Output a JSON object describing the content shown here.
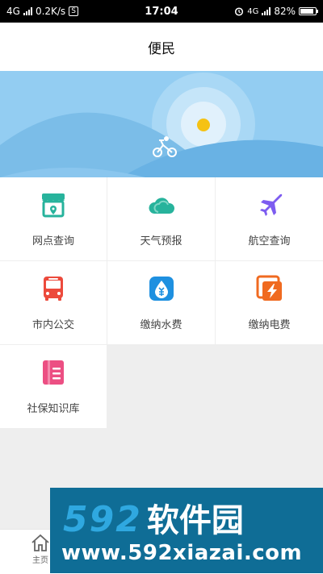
{
  "status_bar": {
    "network_left": "4G",
    "speed": "0.2K/s",
    "speed_badge": "S",
    "time": "17:04",
    "network_right": "4G",
    "battery": "82%"
  },
  "header": {
    "title": "便民"
  },
  "grid": {
    "items": [
      {
        "label": "网点查询",
        "icon": "store-location-icon"
      },
      {
        "label": "天气预报",
        "icon": "cloud-icon"
      },
      {
        "label": "航空查询",
        "icon": "airplane-icon"
      },
      {
        "label": "市内公交",
        "icon": "bus-icon"
      },
      {
        "label": "缴纳水费",
        "icon": "water-drop-icon"
      },
      {
        "label": "缴纳电费",
        "icon": "lightning-icon"
      },
      {
        "label": "社保知识库",
        "icon": "document-icon"
      }
    ]
  },
  "bottom_nav": {
    "home_label": "主页"
  },
  "watermark": {
    "number": "592",
    "name": "软件园",
    "url": "www.592xiazai.com"
  },
  "colors": {
    "teal": "#27b39c",
    "purple": "#7d5cf0",
    "red": "#ec4a3c",
    "blue": "#1e90e0",
    "orange": "#f06a20",
    "pink": "#ec4f83",
    "sky": "#93cdf2"
  }
}
